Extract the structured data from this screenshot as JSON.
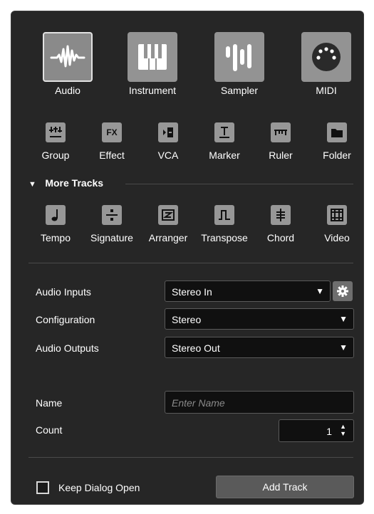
{
  "track_types": [
    {
      "label": "Audio",
      "icon": "audio-waveform-icon",
      "selected": true
    },
    {
      "label": "Instrument",
      "icon": "piano-keys-icon",
      "selected": false
    },
    {
      "label": "Sampler",
      "icon": "sampler-bars-icon",
      "selected": false
    },
    {
      "label": "MIDI",
      "icon": "midi-connector-icon",
      "selected": false
    }
  ],
  "basic_tracks": [
    {
      "label": "Group",
      "icon": "group-icon"
    },
    {
      "label": "Effect",
      "icon": "fx-icon",
      "icon_text": "FX"
    },
    {
      "label": "VCA",
      "icon": "vca-icon"
    },
    {
      "label": "Marker",
      "icon": "marker-icon"
    },
    {
      "label": "Ruler",
      "icon": "ruler-icon"
    },
    {
      "label": "Folder",
      "icon": "folder-icon"
    }
  ],
  "more_tracks": {
    "title": "More Tracks",
    "items": [
      {
        "label": "Tempo",
        "icon": "tempo-note-icon"
      },
      {
        "label": "Signature",
        "icon": "signature-divide-icon"
      },
      {
        "label": "Arranger",
        "icon": "arranger-icon"
      },
      {
        "label": "Transpose",
        "icon": "transpose-icon"
      },
      {
        "label": "Chord",
        "icon": "chord-icon"
      },
      {
        "label": "Video",
        "icon": "video-film-icon"
      }
    ]
  },
  "settings": {
    "audio_inputs": {
      "label": "Audio Inputs",
      "value": "Stereo In"
    },
    "configuration": {
      "label": "Configuration",
      "value": "Stereo"
    },
    "audio_outputs": {
      "label": "Audio Outputs",
      "value": "Stereo Out"
    },
    "name": {
      "label": "Name",
      "placeholder": "Enter Name",
      "value": ""
    },
    "count": {
      "label": "Count",
      "value": "1"
    }
  },
  "footer": {
    "keep_open_label": "Keep Dialog Open",
    "keep_open_checked": false,
    "add_track_label": "Add Track"
  },
  "colors": {
    "background": "#262626",
    "tile": "#939393",
    "field": "#101010",
    "button": "#5a5a5a"
  }
}
